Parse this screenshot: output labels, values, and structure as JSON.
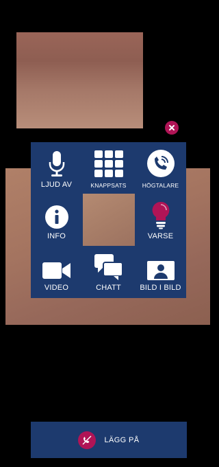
{
  "call": {
    "controls": {
      "mute_label": "LJUD AV",
      "keypad_label": "KNAPPSATS",
      "speaker_label": "HÖGTALARE",
      "info_label": "INFO",
      "alert_label": "VARSE",
      "video_label": "VIDEO",
      "chat_label": "CHATT",
      "pip_label": "BILD I BILD"
    },
    "hangup_label": "LÄGG PÅ"
  },
  "icons": {
    "close": "close-icon",
    "mute": "microphone-icon",
    "keypad": "keypad-grid-icon",
    "speaker": "speaker-phone-icon",
    "info": "info-icon",
    "alert": "lightbulb-icon",
    "video": "video-camera-icon",
    "chat": "chat-bubbles-icon",
    "pip": "person-frame-icon",
    "hangup": "phone-hangup-icon"
  },
  "colors": {
    "panel": "#1d3a6e",
    "accent": "#b01456",
    "background": "#000000"
  }
}
